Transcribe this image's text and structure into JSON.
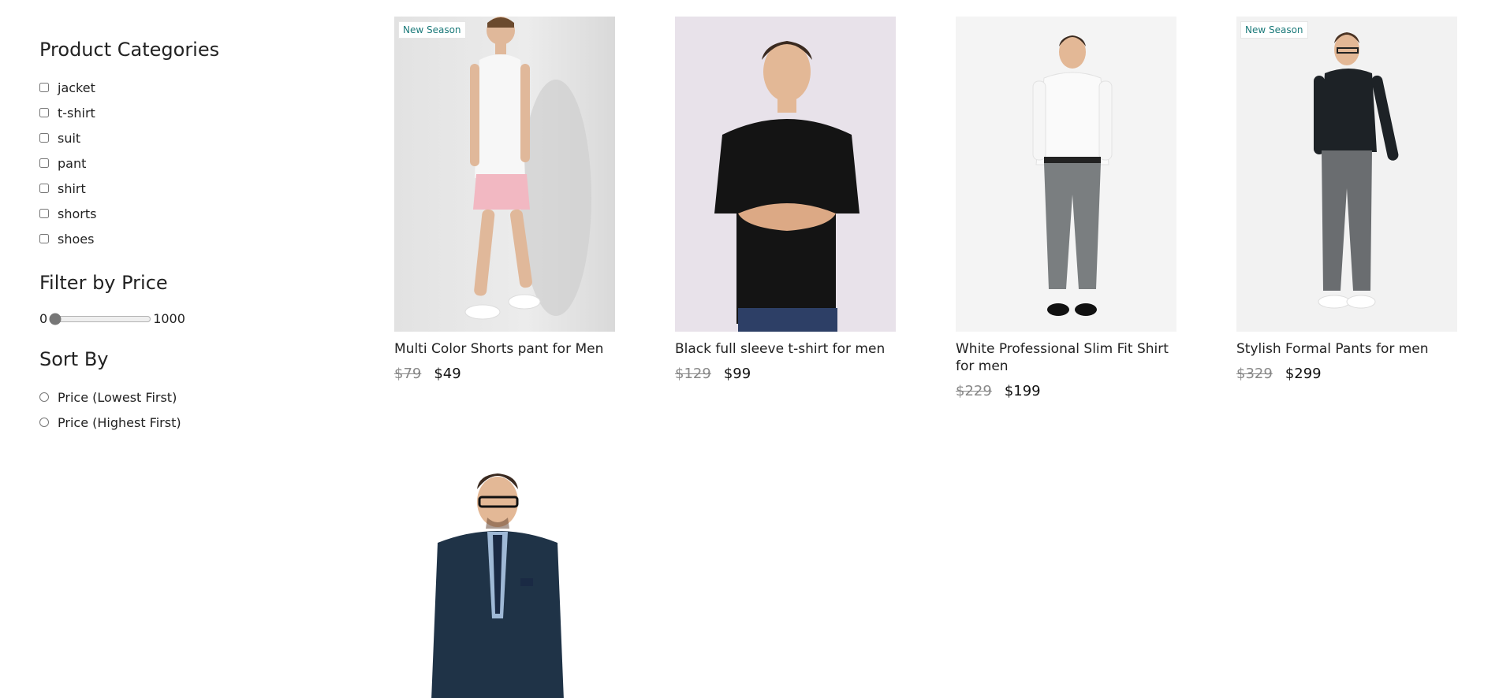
{
  "sidebar": {
    "categories_title": "Product Categories",
    "categories": [
      "jacket",
      "t-shirt",
      "suit",
      "pant",
      "shirt",
      "shorts",
      "shoes"
    ],
    "price_title": "Filter by Price",
    "price_min": "0",
    "price_max": "1000",
    "price_value": 0,
    "sort_title": "Sort By",
    "sort_options": [
      "Price (Lowest First)",
      "Price (Highest First)"
    ]
  },
  "products": [
    {
      "title": "Multi Color Shorts pant for Men",
      "old_price": "$79",
      "price": "$49",
      "badge": "New Season"
    },
    {
      "title": "Black full sleeve t-shirt for men",
      "old_price": "$129",
      "price": "$99",
      "badge": ""
    },
    {
      "title": "White Professional Slim Fit Shirt for men",
      "old_price": "$229",
      "price": "$199",
      "badge": ""
    },
    {
      "title": "Stylish Formal Pants for men",
      "old_price": "$329",
      "price": "$299",
      "badge": "New Season"
    },
    {
      "title": "",
      "old_price": "",
      "price": "",
      "badge": ""
    }
  ],
  "colors": {
    "badge_text": "#1b7a7a",
    "old_price": "#888888"
  }
}
